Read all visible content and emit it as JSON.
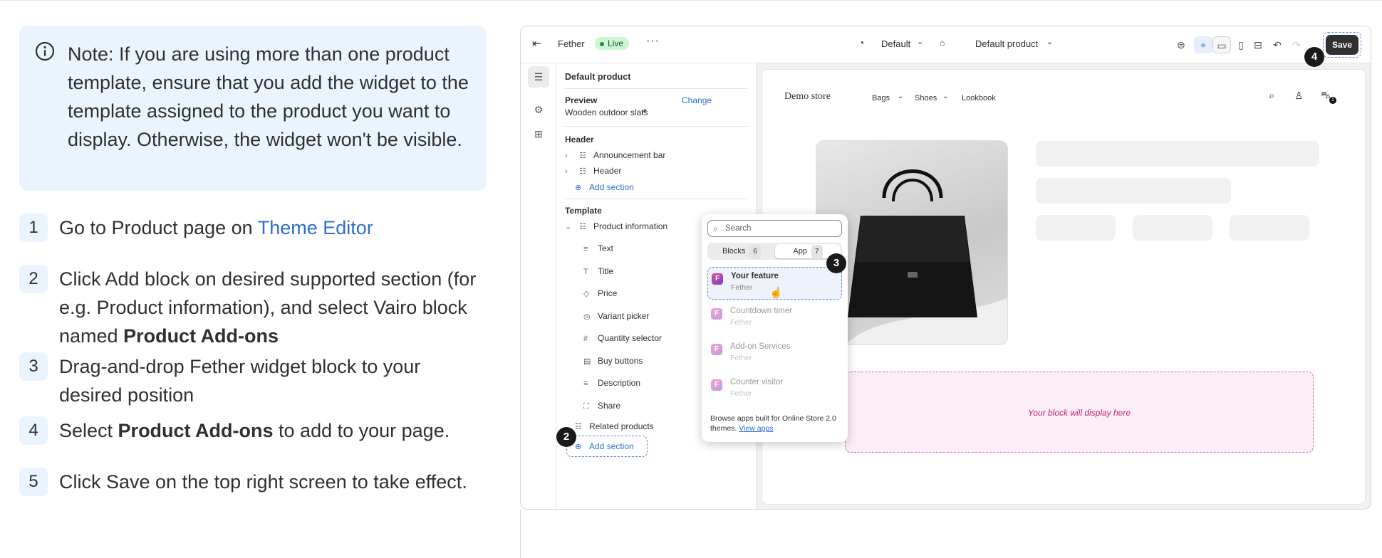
{
  "note": {
    "text": "Note: If you are using more than one product template, ensure that you add the widget to the template assigned to the product you want to display. Otherwise, the widget won't be visible."
  },
  "steps": [
    {
      "num": "1",
      "pre": "Go to Product page on ",
      "link": "Theme Editor"
    },
    {
      "num": "2",
      "pre": "Click Add block on desired supported section (for e.g. Product information), and select Vairo block named ",
      "bold": "Product Add-ons"
    },
    {
      "num": "3",
      "pre": "Drag-and-drop Fether widget block to your desired position"
    },
    {
      "num": "4",
      "pre": "Select ",
      "bold": "Product Add-ons",
      "post": " to add to your page."
    },
    {
      "num": "5",
      "pre": "Click Save on the top right screen to take effect."
    }
  ],
  "toolbar": {
    "app_name": "Fether",
    "status": "Live",
    "theme": "Default",
    "template": "Default product",
    "save": "Save"
  },
  "sidebar": {
    "title": "Default product",
    "preview_label": "Preview",
    "change": "Change",
    "preview_product": "Wooden outdoor slats",
    "header_heading": "Header",
    "header_items": [
      "Announcement bar",
      "Header"
    ],
    "add_section": "Add section",
    "template_heading": "Template",
    "template_section": "Product information",
    "blocks": [
      "Text",
      "Title",
      "Price",
      "Variant picker",
      "Quantity selector",
      "Buy buttons",
      "Description",
      "Share"
    ],
    "related": "Related products",
    "add_section_2": "Add section"
  },
  "store": {
    "name": "Demo store",
    "nav": [
      "Bags",
      "Shoes",
      "Lookbook"
    ],
    "cart_count": "1",
    "block_placeholder": "Your block will display here"
  },
  "popover": {
    "search_placeholder": "Search",
    "tab_blocks": "Blocks",
    "tab_blocks_count": "6",
    "tab_app": "App",
    "tab_app_count": "7",
    "apps": [
      {
        "name": "Your feature",
        "vendor": "Fether"
      },
      {
        "name": "Countdown timer",
        "vendor": "Fether"
      },
      {
        "name": "Add-on Services",
        "vendor": "Fether"
      },
      {
        "name": "Counter visitor",
        "vendor": "Fether"
      }
    ],
    "footer": "Browse apps built for Online Store 2.0 themes.",
    "footer_link": "View apps"
  },
  "badges": [
    "2",
    "3",
    "4"
  ],
  "colors": {
    "note_bg": "#eaf4ff",
    "link": "#2c6ecb",
    "save_bg": "#303030",
    "block_zone": "#fbeef6"
  }
}
